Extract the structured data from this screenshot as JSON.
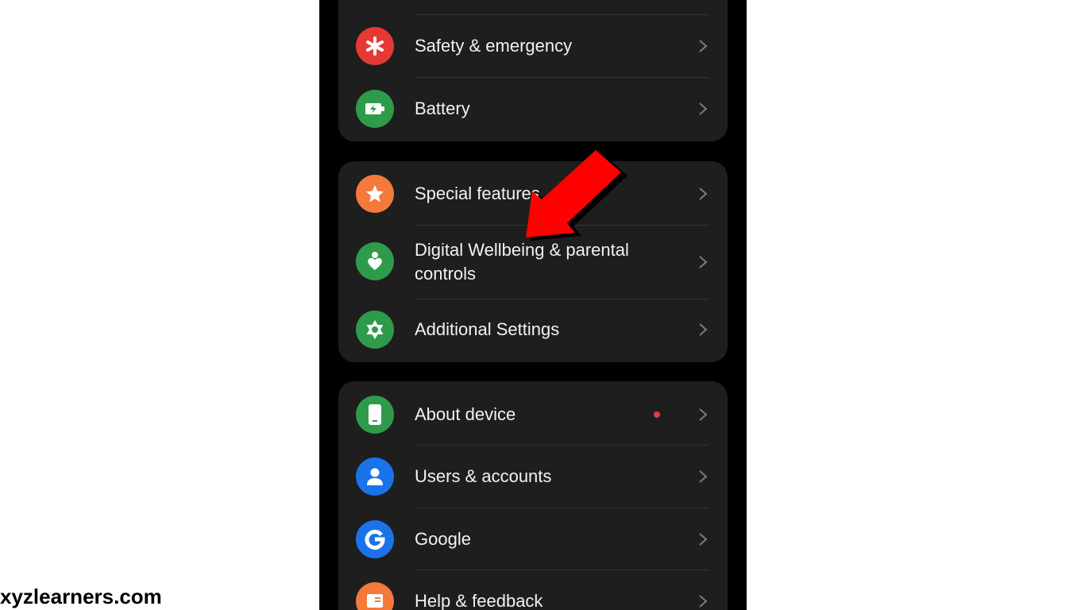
{
  "settings_groups": [
    {
      "items": [
        {
          "label": "Safety & emergency",
          "icon": "asterisk-icon",
          "color": "#e53935"
        },
        {
          "label": "Battery",
          "icon": "battery-icon",
          "color": "#2e9b4a"
        }
      ]
    },
    {
      "items": [
        {
          "label": "Special features",
          "icon": "star-icon",
          "color": "#f4793b"
        },
        {
          "label": "Digital Wellbeing & parental controls",
          "icon": "wellbeing-heart-icon",
          "color": "#2e9b4a"
        },
        {
          "label": "Additional Settings",
          "icon": "gear-icon",
          "color": "#2e9b4a"
        }
      ]
    },
    {
      "items": [
        {
          "label": "About device",
          "icon": "phone-device-icon",
          "color": "#2e9b4a",
          "has_notification_dot": true,
          "dot_color": "#e53945"
        },
        {
          "label": "Users & accounts",
          "icon": "person-icon",
          "color": "#1a73e8"
        },
        {
          "label": "Google",
          "icon": "google-g-icon",
          "color": "#1a73e8"
        },
        {
          "label": "Help & feedback",
          "icon": "help-feedback-icon",
          "color": "#f4793b"
        }
      ]
    }
  ],
  "watermark": "xyzlearners.com",
  "colors": {
    "card_background": "#1e1e1e",
    "phone_background": "#000000",
    "text": "#f2f2f2",
    "annotation_arrow": "#ff0000"
  }
}
